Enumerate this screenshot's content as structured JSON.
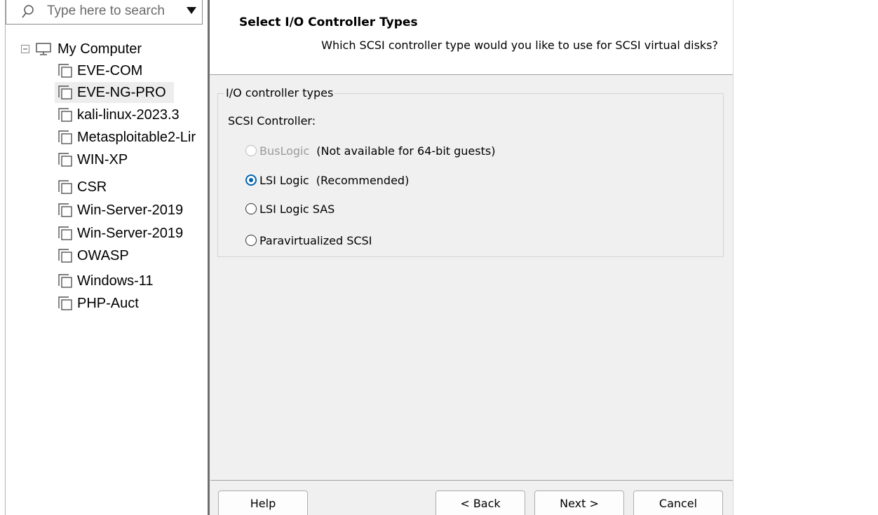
{
  "search": {
    "placeholder": "Type here to search"
  },
  "tree": {
    "root_label": "My Computer",
    "items": [
      {
        "label": "EVE-COM"
      },
      {
        "label": "EVE-NG-PRO",
        "selected": true
      },
      {
        "label": "kali-linux-2023.3"
      },
      {
        "label": "Metasploitable2-Lir"
      },
      {
        "label": "WIN-XP"
      },
      {
        "label": "CSR"
      },
      {
        "label": "Win-Server-2019"
      },
      {
        "label": "Win-Server-2019"
      },
      {
        "label": "OWASP"
      },
      {
        "label": "Windows-11"
      },
      {
        "label": "PHP-Auct"
      }
    ]
  },
  "wizard": {
    "title": "Select I/O Controller Types",
    "subtitle": "Which SCSI controller type would you like to use for SCSI virtual disks?",
    "group_label": "I/O controller types",
    "controller_label": "SCSI Controller:",
    "options": [
      {
        "label": "BusLogic",
        "note": "(Not available for 64-bit guests)",
        "checked": false,
        "disabled": true
      },
      {
        "label": "LSI Logic",
        "note": "(Recommended)",
        "checked": true,
        "disabled": false
      },
      {
        "label": "LSI Logic SAS",
        "note": "",
        "checked": false,
        "disabled": false
      },
      {
        "label": "Paravirtualized SCSI",
        "note": "",
        "checked": false,
        "disabled": false
      }
    ],
    "buttons": {
      "help": "Help",
      "back": "< Back",
      "next": "Next >",
      "cancel": "Cancel"
    }
  },
  "colors": {
    "accent": "#0063b1",
    "dialog_bg": "#f0f0f0",
    "header_bg": "#ffffff"
  }
}
